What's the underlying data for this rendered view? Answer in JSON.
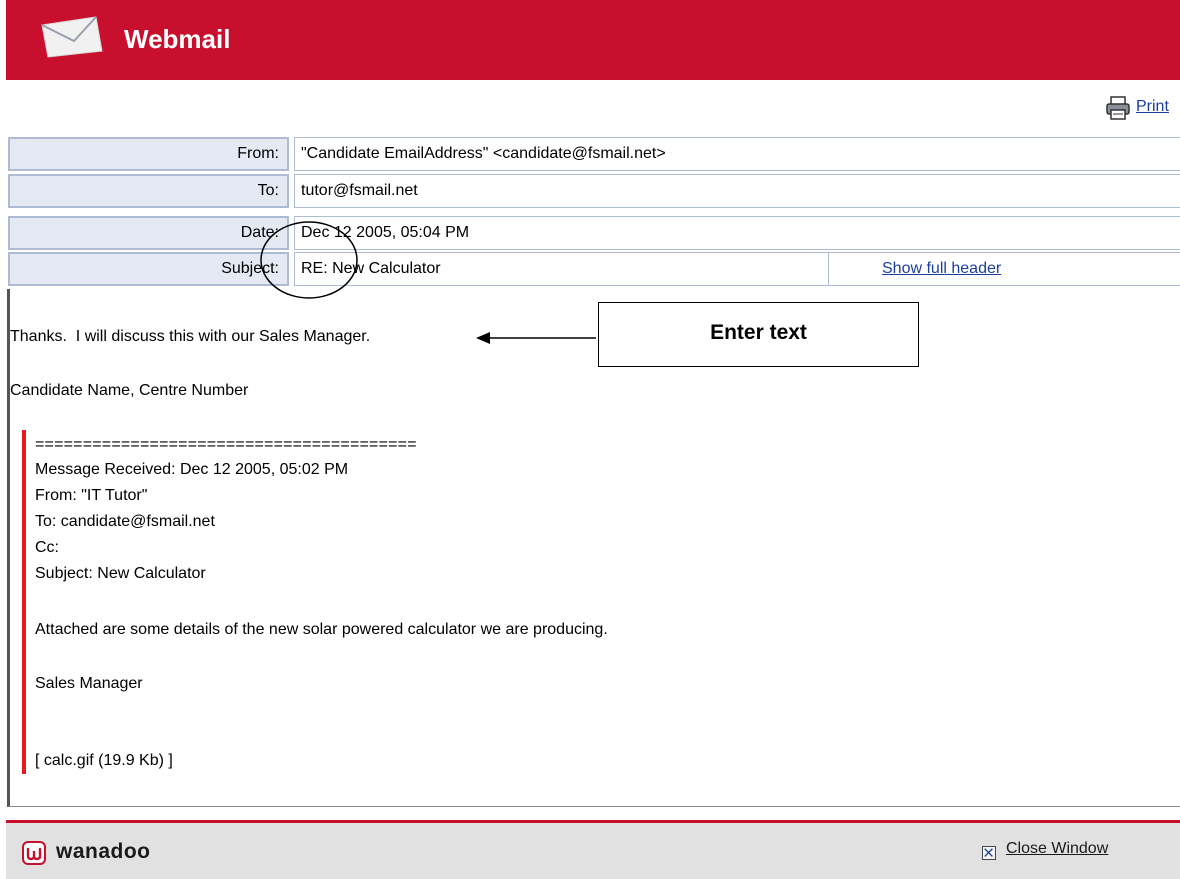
{
  "app": {
    "title": "Webmail"
  },
  "toolbar": {
    "print_label": "Print"
  },
  "header": {
    "rows": [
      {
        "label": "From:",
        "value": "\"Candidate EmailAddress\" <candidate@fsmail.net>"
      },
      {
        "label": "To:",
        "value": "tutor@fsmail.net"
      },
      {
        "label": "Date:",
        "value": "Dec 12 2005, 05:04 PM"
      },
      {
        "label": "Subject:",
        "value": "RE: New Calculator"
      }
    ],
    "show_full_header": "Show full header"
  },
  "message": {
    "reply_line": "Thanks.  I will discuss this with our Sales Manager.",
    "signature": "Candidate Name, Centre Number",
    "quoted": {
      "separator": "========================================",
      "received": "Message Received: Dec 12 2005, 05:02 PM",
      "from": "From: \"IT Tutor\"",
      "to": "To: candidate@fsmail.net",
      "cc": "Cc:",
      "subject": "Subject: New Calculator",
      "body": "Attached are some details of the new solar powered calculator we are producing.",
      "signoff": "Sales Manager",
      "attachment": "[ calc.gif (19.9 Kb) ]"
    }
  },
  "annotation": {
    "callout_text": "Enter text"
  },
  "footer": {
    "brand": "wanadoo",
    "close_label": "Close Window"
  },
  "colors": {
    "brand_red": "#c8102e",
    "label_bg": "#e4e9f3",
    "link_blue": "#1b3fa0",
    "quote_bar": "#e8191f"
  }
}
